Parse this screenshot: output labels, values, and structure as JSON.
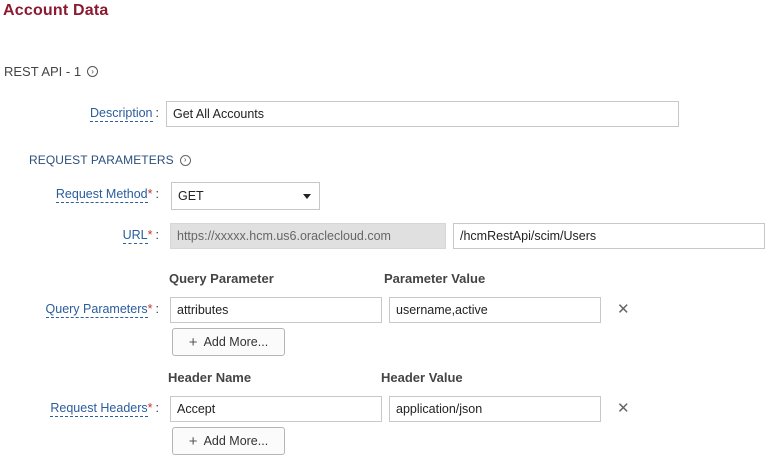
{
  "page": {
    "title": "Account Data"
  },
  "section": {
    "title": "REST API - 1"
  },
  "description": {
    "label": "Description",
    "colon": ":",
    "value": "Get All Accounts"
  },
  "request_parameters": {
    "title": "REQUEST PARAMETERS"
  },
  "request_method": {
    "label": "Request Method",
    "required": "*",
    "colon": ":",
    "selected": "GET"
  },
  "url": {
    "label": "URL",
    "required": "*",
    "colon": ":",
    "base": "https://xxxxx.hcm.us6.oraclecloud.com",
    "path": "/hcmRestApi/scim/Users"
  },
  "query_parameters": {
    "label": "Query Parameters",
    "required": "*",
    "colon": ":",
    "col_name": "Query Parameter",
    "col_value": "Parameter Value",
    "rows": [
      {
        "name": "attributes",
        "value": "username,active"
      }
    ],
    "add_more": "Add More..."
  },
  "request_headers": {
    "label": "Request Headers",
    "required": "*",
    "colon": ":",
    "col_name": "Header Name",
    "col_value": "Header Value",
    "rows": [
      {
        "name": "Accept",
        "value": "application/json"
      }
    ],
    "add_more": "Add More..."
  },
  "icons": {
    "remove": "close-icon",
    "expand": "chevron-right-circle-icon",
    "add": "plus-icon",
    "dropdown": "caret-down-icon"
  }
}
